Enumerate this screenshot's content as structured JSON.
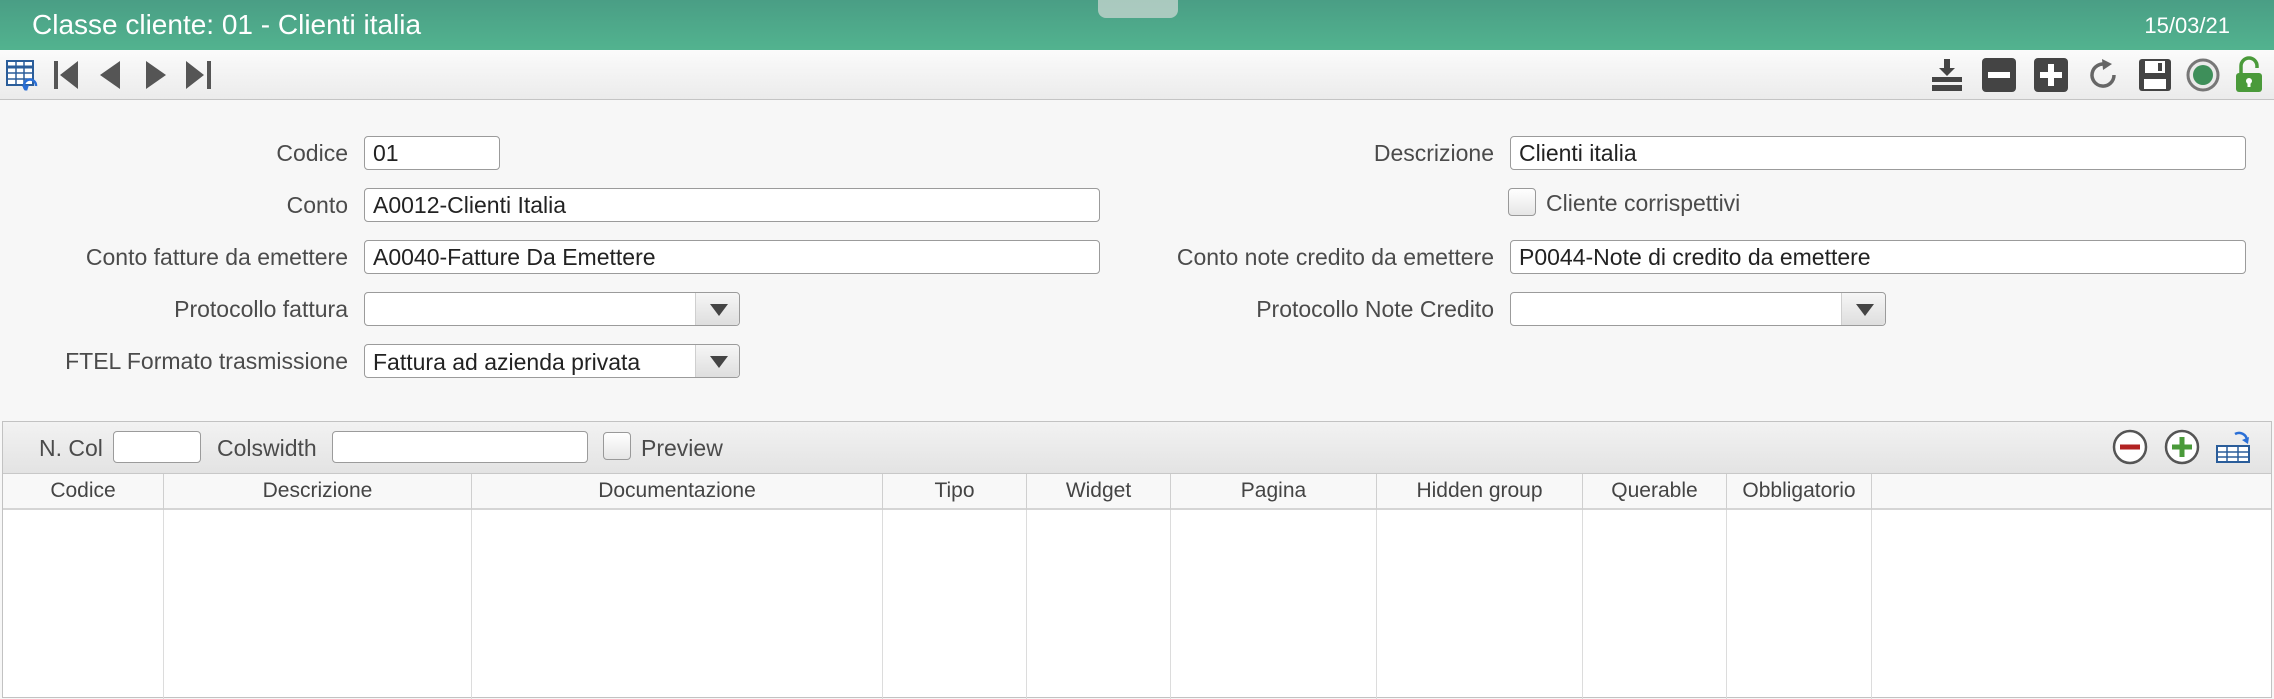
{
  "window": {
    "title": "Classe cliente: 01 - Clienti italia",
    "date": "15/03/21"
  },
  "toolbar": {
    "left_icons": [
      "grid-refresh-icon",
      "first-record-icon",
      "previous-record-icon",
      "next-record-icon",
      "last-record-icon"
    ],
    "right_icons": [
      "archive-icon",
      "remove-icon",
      "add-icon",
      "refresh-icon",
      "save-icon",
      "status-icon",
      "lock-open-icon"
    ]
  },
  "form": {
    "codice": {
      "label": "Codice",
      "value": "01"
    },
    "descrizione": {
      "label": "Descrizione",
      "value": "Clienti italia"
    },
    "conto": {
      "label": "Conto",
      "value": "A0012-Clienti Italia"
    },
    "cliente_corrispettivi": {
      "label": "Cliente corrispettivi",
      "checked": false
    },
    "conto_fatture": {
      "label": "Conto fatture da emettere",
      "value": "A0040-Fatture Da Emettere"
    },
    "conto_note": {
      "label": "Conto note credito da emettere",
      "value": "P0044-Note di credito da emettere"
    },
    "protocollo_fattura": {
      "label": "Protocollo fattura",
      "value": ""
    },
    "protocollo_note": {
      "label": "Protocollo Note Credito",
      "value": ""
    },
    "ftel": {
      "label": "FTEL Formato trasmissione",
      "value": "Fattura ad azienda privata"
    }
  },
  "grid": {
    "ncol_label": "N. Col",
    "ncol_value": "",
    "colswidth_label": "Colswidth",
    "colswidth_value": "",
    "preview_label": "Preview",
    "columns": [
      "Codice",
      "Descrizione",
      "Documentazione",
      "Tipo",
      "Widget",
      "Pagina",
      "Hidden group",
      "Querable",
      "Obbligatorio"
    ],
    "rows": []
  },
  "colors": {
    "title_bar": "#52b38f",
    "remove": "#b22222",
    "add": "#4a9a3a",
    "status": "#3e8f5a",
    "lock": "#4a9a3a"
  }
}
